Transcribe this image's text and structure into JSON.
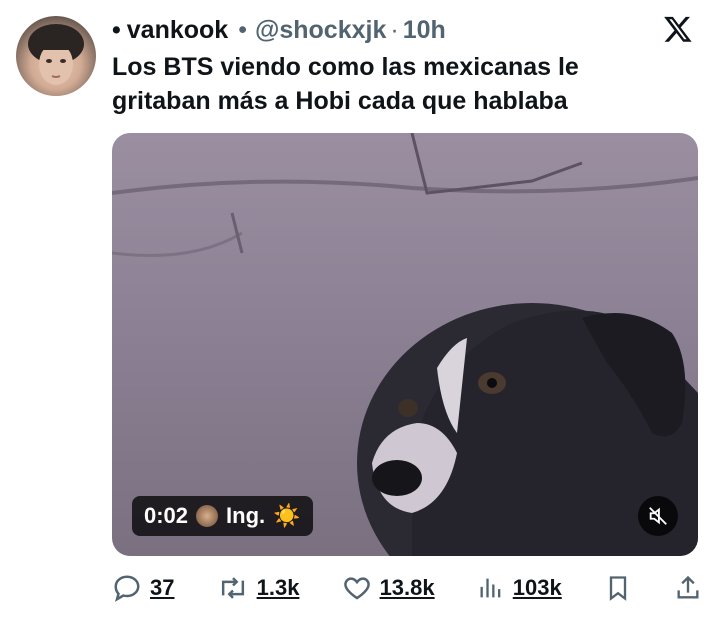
{
  "tweet": {
    "display_name": "vankook",
    "handle": "@shockxjk",
    "time": "10h",
    "bullet": "•",
    "sep": "•",
    "sep2": "·",
    "text": "Los BTS viendo como las mexicanas le gritaban más a Hobi cada que hablaba"
  },
  "media": {
    "timestamp": "0:02",
    "caption_badge": "Ing.",
    "badge_emoji": "☀️"
  },
  "actions": {
    "replies": "37",
    "retweets": "1.3k",
    "likes": "13.8k",
    "views": "103k"
  },
  "icons": {
    "x_logo": "x-logo-icon",
    "reply": "reply-icon",
    "retweet": "retweet-icon",
    "like": "heart-icon",
    "views": "views-icon",
    "bookmark": "bookmark-icon",
    "share": "share-icon",
    "mute": "mute-icon"
  }
}
